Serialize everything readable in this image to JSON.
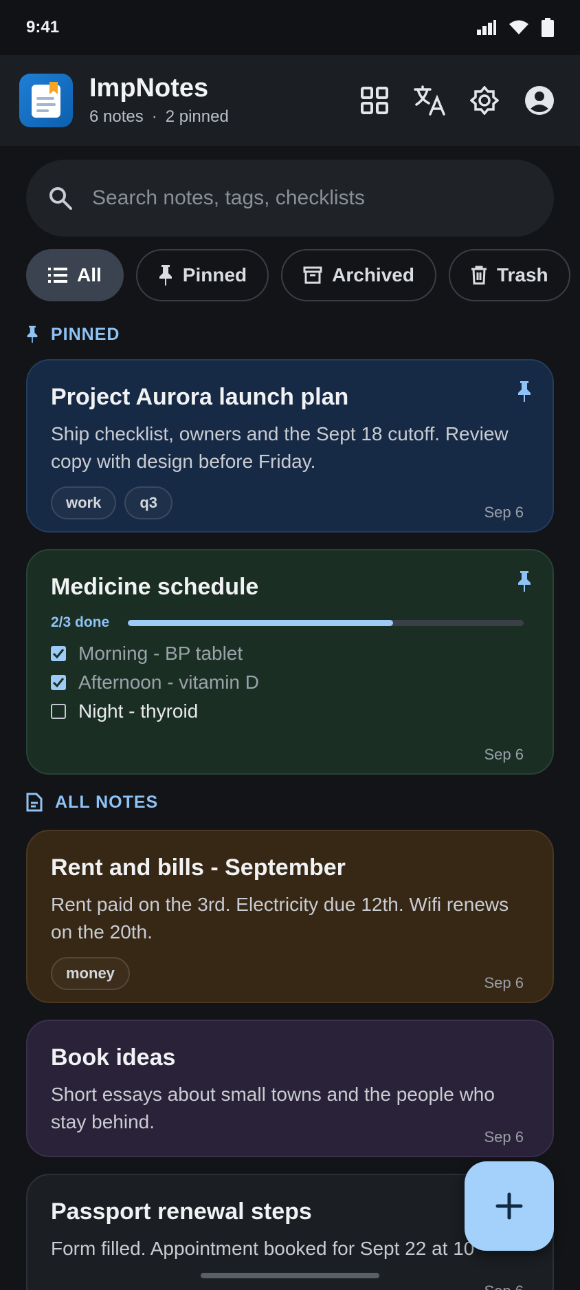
{
  "status": {
    "time": "9:41"
  },
  "app": {
    "title": "ImpNotes",
    "notes_count": "6 notes",
    "separator": "·",
    "pinned_count": "2 pinned"
  },
  "search": {
    "placeholder": "Search notes, tags, checklists",
    "value": ""
  },
  "filters": [
    {
      "label": "All",
      "icon": "list-icon",
      "active": true
    },
    {
      "label": "Pinned",
      "icon": "pin-icon",
      "active": false
    },
    {
      "label": "Archived",
      "icon": "archive-icon",
      "active": false
    },
    {
      "label": "Trash",
      "icon": "trash-icon",
      "active": false
    }
  ],
  "sections": {
    "pinned": "PINNED",
    "all": "ALL NOTES"
  },
  "notes": [
    {
      "title": "Project Aurora launch plan",
      "body": "Ship checklist, owners and the Sept 18 cutoff. Review copy with design before Friday.",
      "tags": [
        "work",
        "q3"
      ],
      "date": "Sep 6",
      "pinned": true,
      "color": "#172a45"
    },
    {
      "title": "Medicine schedule",
      "progress_label": "2/3 done",
      "progress": 0.67,
      "checklist": [
        {
          "text": "Morning - BP tablet",
          "checked": true
        },
        {
          "text": "Afternoon - vitamin D",
          "checked": true
        },
        {
          "text": "Night - thyroid",
          "checked": false
        }
      ],
      "date": "Sep 6",
      "pinned": true,
      "color": "#1a2e24"
    },
    {
      "title": "Rent and bills - September",
      "body": "Rent paid on the 3rd. Electricity due 12th. Wifi renews on the 20th.",
      "tags": [
        "money"
      ],
      "date": "Sep 6",
      "color": "#372815"
    },
    {
      "title": "Book ideas",
      "body": "Short essays about small towns and the people who stay behind.",
      "date": "Sep 6",
      "color": "#2a2238"
    },
    {
      "title": "Passport renewal steps",
      "body": "Form filled. Appointment booked for Sept 22 at 10",
      "date": "Sep 6",
      "color": "#1b1e22"
    }
  ],
  "colors": {
    "accent": "#8fc3f5",
    "fab": "#a3d1fb",
    "background": "#121417"
  }
}
